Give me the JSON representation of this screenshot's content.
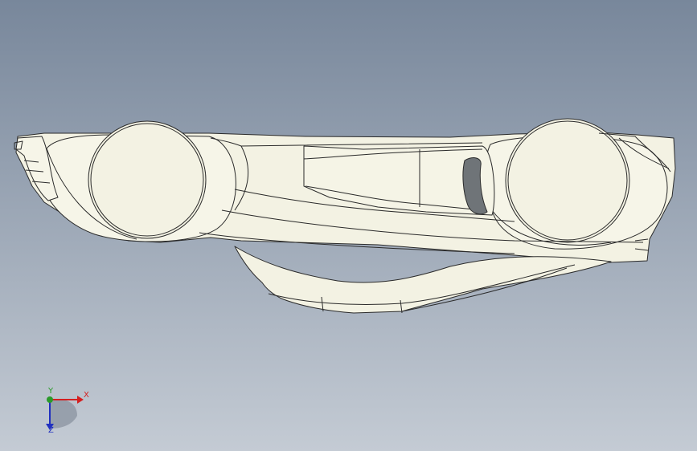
{
  "viewport": {
    "background_top": "#78879b",
    "background_bottom": "#c4cbd4"
  },
  "model": {
    "body_color": "#f3f2e3",
    "edge_color": "#2a2a2a",
    "shadow_color": "#d6d5c3",
    "opening_color": "#6f7478"
  },
  "triad": {
    "x_label": "X",
    "y_label": "Y",
    "z_label": "Z",
    "x_color": "#d42020",
    "y_color": "#2a9a2a",
    "z_color": "#2030c0"
  }
}
